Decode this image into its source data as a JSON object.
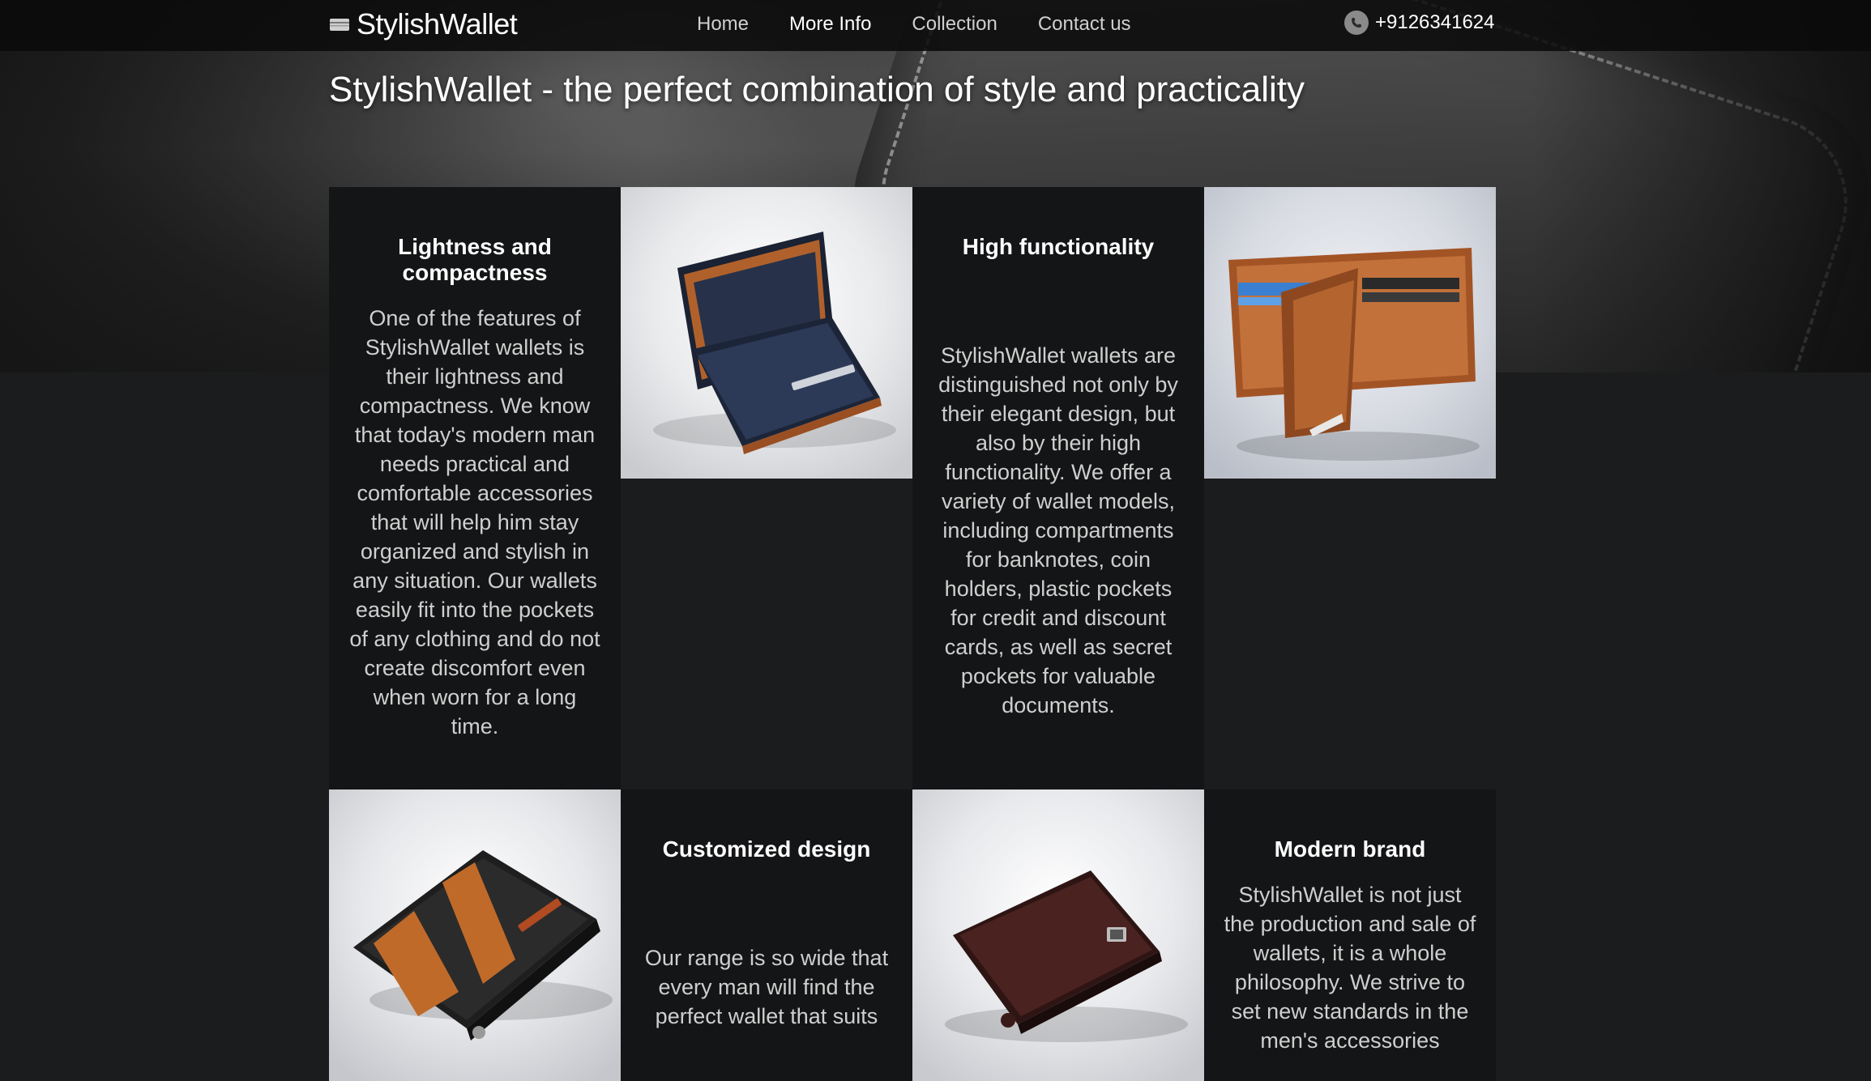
{
  "header": {
    "brand": "StylishWallet",
    "brand_icon": "wallet-icon",
    "nav": [
      {
        "label": "Home",
        "active": false
      },
      {
        "label": "More Info",
        "active": true
      },
      {
        "label": "Collection",
        "active": false
      },
      {
        "label": "Contact us",
        "active": false
      }
    ],
    "phone_icon": "phone-icon",
    "phone": "+9126341624"
  },
  "hero": {
    "title": "StylishWallet - the perfect combination of style and practicality"
  },
  "features": [
    {
      "title": "Lightness and compactness",
      "text": "One of the features of StylishWallet wallets is their lightness and compactness. We know that today's modern man needs practical and comfortable accessories that will help him stay organized and stylish in any situation. Our wallets easily fit into the pockets of any clothing and do not create discomfort even when worn for a long time."
    },
    {
      "title": "High functionality",
      "text": "StylishWallet wallets are distinguished not only by their elegant design, but also by their high functionality. We offer a variety of wallet models, including compartments for banknotes, coin holders, plastic pockets for credit and discount cards, as well as secret pockets for valuable documents."
    },
    {
      "title": "Customized design",
      "text": "Our range is so wide that every man will find the perfect wallet that suits"
    },
    {
      "title": "Modern brand",
      "text": "StylishWallet is not just the production and sale of wallets, it is a whole philosophy. We strive to set new standards in the men's accessories"
    }
  ],
  "images": [
    {
      "name": "navy-leather-wallet-photo"
    },
    {
      "name": "tan-leather-wallet-photo"
    },
    {
      "name": "black-tan-stripe-wallet-photo"
    },
    {
      "name": "brown-leather-wallet-photo"
    }
  ],
  "colors": {
    "page_bg": "#1b1c1d",
    "card_bg": "#141516",
    "header_bg": "#0a0a0a",
    "text_primary": "#ffffff",
    "text_secondary": "#cfcfcf"
  }
}
